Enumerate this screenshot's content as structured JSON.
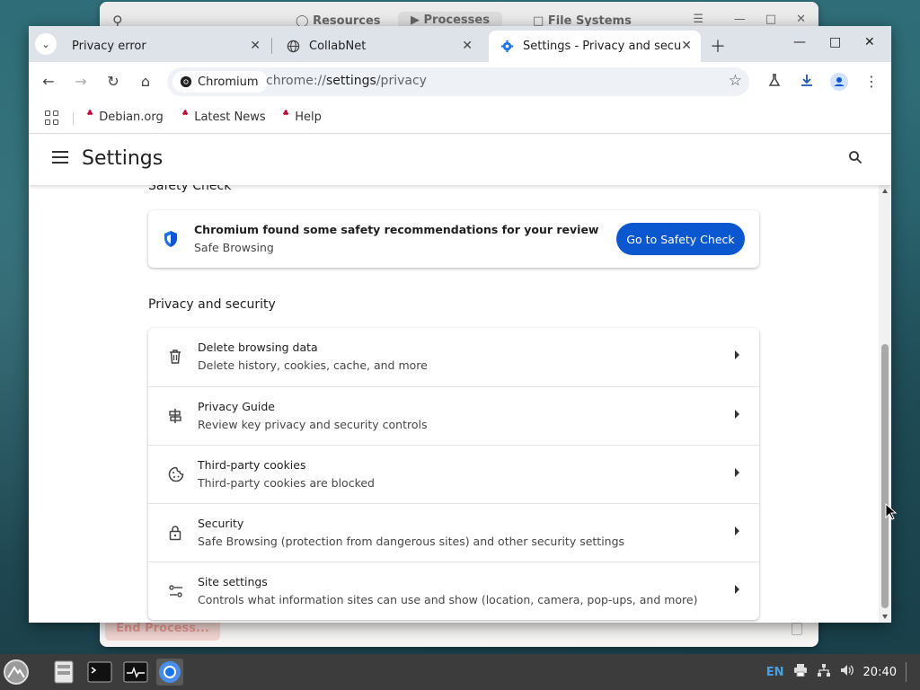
{
  "background_window": {
    "tabs": [
      "Resources",
      "Processes",
      "File Systems"
    ],
    "end_process_label": "End Process..."
  },
  "browser": {
    "tabs": [
      {
        "title": "Privacy error",
        "icon": "chevron-down-icon"
      },
      {
        "title": "CollabNet",
        "icon": "globe-icon"
      },
      {
        "title": "Settings - Privacy and secu",
        "icon": "gear-icon",
        "active": true
      }
    ],
    "omnibox": {
      "chip_label": "Chromium",
      "url_scheme": "chrome://",
      "url_host": "settings",
      "url_path": "/privacy"
    },
    "bookmarks": [
      "Debian.org",
      "Latest News",
      "Help"
    ],
    "settings_title": "Settings"
  },
  "safety_check": {
    "heading": "Safety Check",
    "title": "Chromium found some safety recommendations for your review",
    "subtitle": "Safe Browsing",
    "button": "Go to Safety Check"
  },
  "privacy": {
    "heading": "Privacy and security",
    "rows": [
      {
        "title": "Delete browsing data",
        "subtitle": "Delete history, cookies, cache, and more",
        "icon": "trash-icon"
      },
      {
        "title": "Privacy Guide",
        "subtitle": "Review key privacy and security controls",
        "icon": "signpost-icon"
      },
      {
        "title": "Third-party cookies",
        "subtitle": "Third-party cookies are blocked",
        "icon": "cookie-icon"
      },
      {
        "title": "Security",
        "subtitle": "Safe Browsing (protection from dangerous sites) and other security settings",
        "icon": "lock-icon"
      },
      {
        "title": "Site settings",
        "subtitle": "Controls what information sites can use and show (location, camera, pop-ups, and more)",
        "icon": "tune-icon"
      }
    ]
  },
  "taskbar": {
    "language": "EN",
    "clock": "20:40"
  },
  "colors": {
    "accent": "#0b57d0",
    "tabstrip": "#dee3ea",
    "debian_red": "#c70036"
  }
}
